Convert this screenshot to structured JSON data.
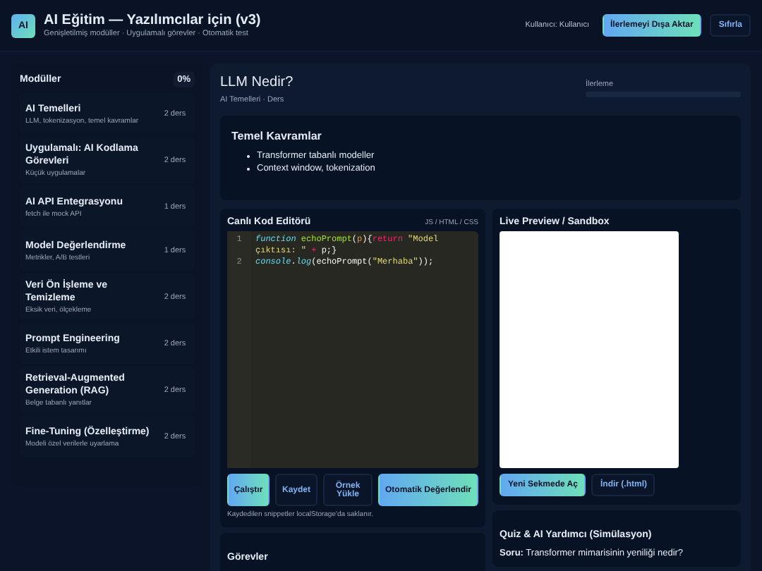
{
  "header": {
    "logo": "AI",
    "title": "AI Eğitim — Yazılımcılar için (v3)",
    "subtitle": "Genişletilmiş modüller · Uygulamalı görevler · Otomatik test",
    "user": "Kullanıcı: Kullanıcı",
    "buttons": [
      {
        "label": "İlerlemeyi Dışa Aktar",
        "kind": "primary"
      },
      {
        "label": "Sıfırla",
        "kind": "ghost"
      }
    ]
  },
  "sidebar": {
    "title": "Modüller",
    "percent": "0%",
    "items": [
      {
        "title": "AI Temelleri",
        "desc": "LLM, tokenizasyon, temel kavramlar",
        "count": "2 ders"
      },
      {
        "title": "Uygulamalı: AI Kodlama Görevleri",
        "desc": "Küçük uygulamalar",
        "count": "2 ders"
      },
      {
        "title": "AI API Entegrasyonu",
        "desc": "fetch ile mock API",
        "count": "1 ders"
      },
      {
        "title": "Model Değerlendirme",
        "desc": "Metrikler, A/B testleri",
        "count": "1 ders"
      },
      {
        "title": "Veri Ön İşleme ve Temizleme",
        "desc": "Eksik veri, ölçekleme",
        "count": "2 ders"
      },
      {
        "title": "Prompt Engineering",
        "desc": "Etkili istem tasarımı",
        "count": "2 ders"
      },
      {
        "title": "Retrieval-Augmented Generation (RAG)",
        "desc": "Belge tabanlı yanıtlar",
        "count": "2 ders"
      },
      {
        "title": "Fine-Tuning (Özelleştirme)",
        "desc": "Modeli özel verilerle uyarlama",
        "count": "2 ders"
      }
    ]
  },
  "lesson": {
    "title": "LLM Nedir?",
    "breadcrumb": "AI Temelleri · Ders",
    "progress_label": "İlerleme",
    "level": 0,
    "concepts": {
      "title": "Temel Kavramlar",
      "bullets": [
        "Transformer tabanlı modeller",
        "Context window, tokenization"
      ]
    }
  },
  "editor": {
    "title": "Canlı Kod Editörü",
    "langs": "JS / HTML / CSS",
    "lines": [
      {
        "number": "1",
        "tokens": [
          {
            "text": "function",
            "kind": "keyword"
          },
          {
            "text": " echoPrompt",
            "kind": "fn"
          },
          {
            "text": "(",
            "kind": "punct"
          },
          {
            "text": "p",
            "kind": "param"
          },
          {
            "text": "){",
            "kind": "punct"
          },
          {
            "text": "return",
            "kind": "op"
          },
          {
            "text": " \"Model çıktısı: \"",
            "kind": "string"
          },
          {
            "text": " + ",
            "kind": "op"
          },
          {
            "text": "p;}",
            "kind": "punct"
          }
        ]
      },
      {
        "number": "2",
        "tokens": [
          {
            "text": "console",
            "kind": "keyword"
          },
          {
            "text": ".",
            "kind": "punct"
          },
          {
            "text": "log",
            "kind": "keyword"
          },
          {
            "text": "(echoPrompt(",
            "kind": "punct"
          },
          {
            "text": "\"Merhaba\"",
            "kind": "string"
          },
          {
            "text": "));",
            "kind": "punct"
          }
        ]
      }
    ],
    "buttons": [
      {
        "label": "Çalıştır",
        "kind": "primary"
      },
      {
        "label": "Kaydet",
        "kind": "ghost"
      },
      {
        "label": "Örnek Yükle",
        "kind": "ghost"
      },
      {
        "label": "Otomatik Değerlendir",
        "kind": "primary"
      }
    ],
    "note": "Kaydedilen snippetler localStorage'da saklanır."
  },
  "preview": {
    "title": "Live Preview / Sandbox",
    "buttons": [
      {
        "label": "Yeni Sekmede Aç",
        "kind": "primary"
      },
      {
        "label": "İndir (.html)",
        "kind": "ghost"
      }
    ]
  },
  "quiz": {
    "title": "Quiz & AI Yardımcı (Simülasyon)",
    "question": "**Soru:** Transformer mimarisinin yeniliği nedir?"
  },
  "tasks": {
    "title": "Görevler"
  }
}
